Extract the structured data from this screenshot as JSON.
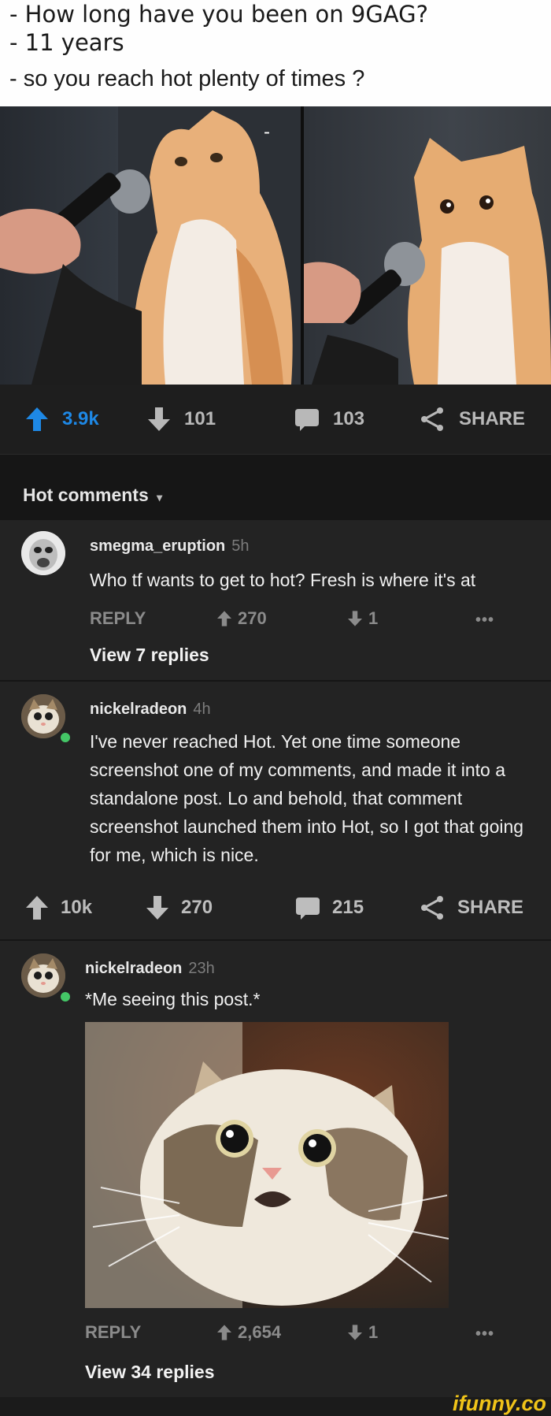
{
  "meme": {
    "line1": "- How long have you been on 9GAG?",
    "line2": "- 11 years",
    "line3": "- so you reach hot plenty of times ?",
    "panel_dash": "-"
  },
  "post_bar": {
    "upvotes": "3.9k",
    "downvotes": "101",
    "comments": "103",
    "share": "SHARE"
  },
  "hot_comments": {
    "title": "Hot comments",
    "caret": "▾"
  },
  "comment1": {
    "user": "smegma_eruption",
    "time": "5h",
    "text": "Who tf wants to get to hot? Fresh is where it's at",
    "reply": "REPLY",
    "up": "270",
    "down": "1",
    "more": "•••",
    "view_replies": "View 7 replies"
  },
  "comment2": {
    "user": "nickelradeon",
    "time": "4h",
    "text": "I've never reached Hot. Yet one time someone screenshot one of my comments, and made it into a standalone post. Lo and behold, that comment screenshot launched them into Hot, so I got that going for me, which is nice.",
    "bar": {
      "upvotes": "10k",
      "downvotes": "270",
      "comments": "215",
      "share": "SHARE"
    }
  },
  "comment3": {
    "user": "nickelradeon",
    "time": "23h",
    "text": "*Me seeing this post.*",
    "reply": "REPLY",
    "up": "2,654",
    "down": "1",
    "more": "•••",
    "view_replies": "View 34 replies"
  },
  "watermark": "ifunny.co",
  "colors": {
    "accent": "#1e88e5",
    "online": "#44c767",
    "brand": "#f0c419"
  }
}
